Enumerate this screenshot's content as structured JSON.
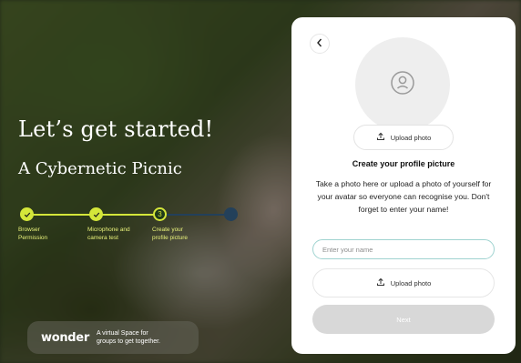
{
  "colors": {
    "accent": "#d4e63a",
    "todo_step": "#23405a",
    "input_border": "#9fd3d0",
    "next_disabled": "#d8d8d8"
  },
  "hero": {
    "headline": "Let’s get started!",
    "subhead": "A Cybernetic Picnic"
  },
  "progress": {
    "current_step": 3,
    "steps": [
      {
        "label_line1": "Browser",
        "label_line2": "Permission",
        "state": "done"
      },
      {
        "label_line1": "Microphone and",
        "label_line2": "camera test",
        "state": "done"
      },
      {
        "label_line1": "Create your",
        "label_line2": "profile picture",
        "state": "active",
        "number": "3"
      },
      {
        "label_line1": "",
        "label_line2": "",
        "state": "todo"
      }
    ]
  },
  "brand": {
    "logo": "wonder",
    "tagline": "A virtual Space for\ngroups to get together."
  },
  "card": {
    "back_icon": "chevron-left-icon",
    "avatar_icon": "user-icon",
    "upload_top_label": "Upload photo",
    "title": "Create your profile picture",
    "description": "Take a photo here or upload a photo of yourself for your avatar so everyone can recognise you. Don't forget to enter your name!",
    "name_placeholder": "Enter your name",
    "name_value": "",
    "upload_label": "Upload photo",
    "next_label": "Next"
  }
}
